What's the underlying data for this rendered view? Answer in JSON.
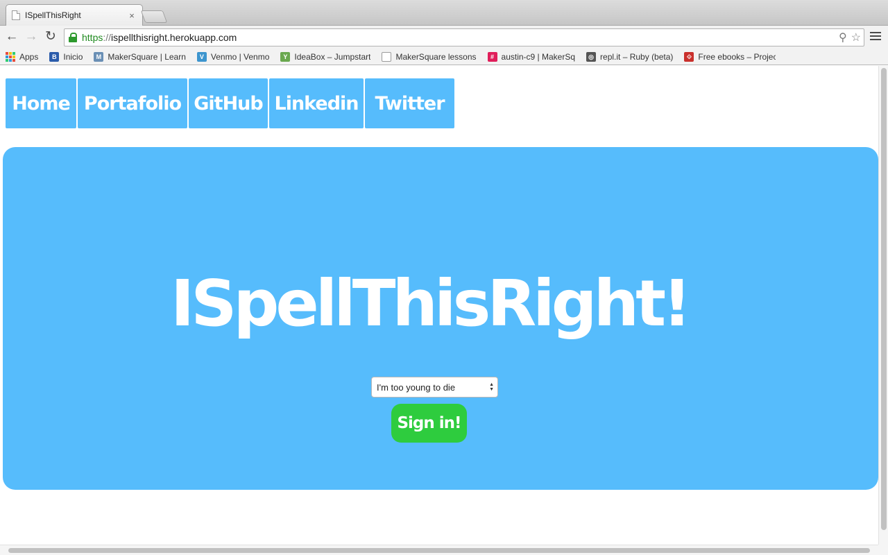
{
  "browser": {
    "tab": {
      "title": "ISpellThisRight",
      "close_icon": "×"
    },
    "url": {
      "scheme": "https",
      "separator": "://",
      "host": "ispellthisright.herokuapp.com"
    },
    "nav_icons": {
      "back": "←",
      "forward": "→",
      "reload": "↻"
    },
    "omnibox_icons": {
      "search": "⚲",
      "bookmark": "☆"
    }
  },
  "bookmarks": [
    {
      "label": "Apps",
      "icon": "apps-grid-icon"
    },
    {
      "label": "Inicio",
      "icon": "bb-icon",
      "glyph": "B",
      "color": "#2b5cab"
    },
    {
      "label": "MakerSquare | Learn",
      "icon": "makersquare-icon",
      "glyph": "M",
      "color": "#6a8fb5"
    },
    {
      "label": "Venmo | Venmo",
      "icon": "venmo-icon",
      "glyph": "V",
      "color": "#3d95ce"
    },
    {
      "label": "IdeaBox – Jumpstart",
      "icon": "ideabox-icon",
      "glyph": "Y",
      "color": "#6aa84f"
    },
    {
      "label": "MakerSquare lessons",
      "icon": "document-icon",
      "glyph": "",
      "color": "#ffffff"
    },
    {
      "label": "austin-c9 | MakerSq",
      "icon": "slack-icon",
      "glyph": "#",
      "color": "#e01e5a"
    },
    {
      "label": "repl.it – Ruby (beta)",
      "icon": "replit-icon",
      "glyph": "◎",
      "color": "#555555"
    },
    {
      "label": "Free ebooks – Projec",
      "icon": "gutenberg-icon",
      "glyph": "⟐",
      "color": "#c9302c"
    }
  ],
  "nav": [
    {
      "label": "Home",
      "key": "home"
    },
    {
      "label": "Portafolio",
      "key": "portafolio"
    },
    {
      "label": "GitHub",
      "key": "github"
    },
    {
      "label": "Linkedin",
      "key": "linkedin"
    },
    {
      "label": "Twitter",
      "key": "twitter"
    }
  ],
  "hero": {
    "title": "ISpellThisRight!",
    "difficulty": {
      "selected": "I'm too young to die"
    },
    "signin_label": "Sign in!"
  },
  "colors": {
    "nav_blue": "#56bcfc",
    "hero_blue": "#56bcfc",
    "signin_green": "#2ecc3e",
    "text_white": "#ffffff"
  }
}
